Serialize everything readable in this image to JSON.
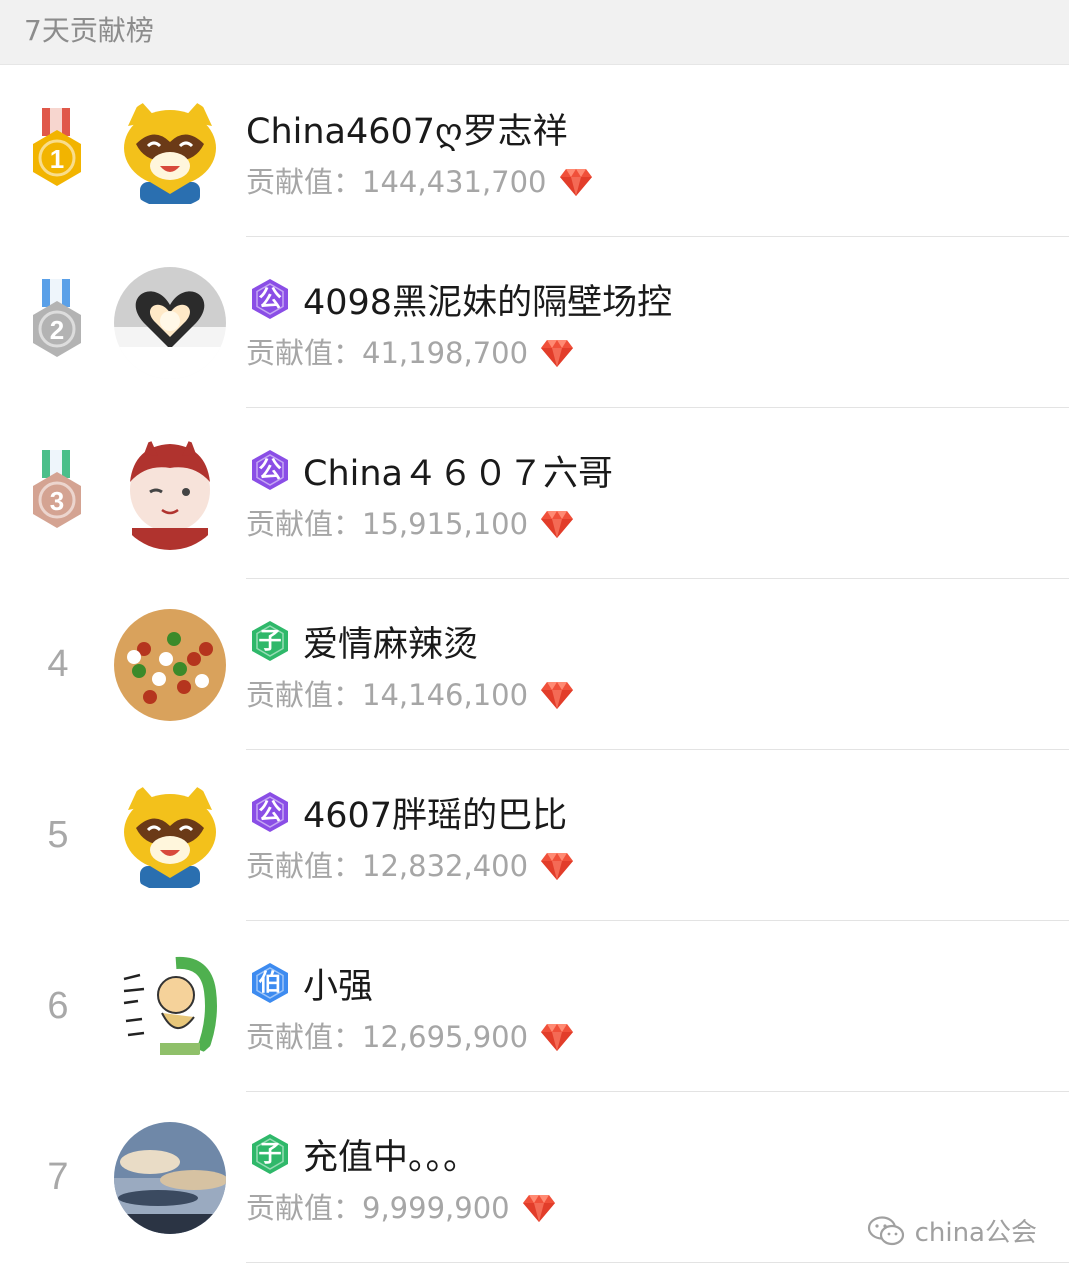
{
  "header": {
    "title": "7天贡献榜"
  },
  "value_label": "贡献值：",
  "watermark": {
    "text": "china公会"
  },
  "colors": {
    "gold": "#f2b400",
    "silver": "#b3b3b3",
    "bronze": "#d4a392",
    "badge_gong": "#8a4ee6",
    "badge_zi": "#2fb86a",
    "badge_bo": "#3d8bf0",
    "gem": "#f0503a"
  },
  "rows": [
    {
      "rank": "1",
      "name": "China4607ღ罗志祥",
      "badge": "",
      "badge_type": "none",
      "value": "144,431,700",
      "avatar": "raccoon-mascot",
      "medal": "gold"
    },
    {
      "rank": "2",
      "name": "4098黑泥妹的隔壁场控",
      "badge": "公",
      "badge_type": "gong",
      "value": "41,198,700",
      "avatar": "heart-hands",
      "medal": "silver"
    },
    {
      "rank": "3",
      "name": "China４６０７六哥",
      "badge": "公",
      "badge_type": "gong",
      "value": "15,915,100",
      "avatar": "cartoon-boy",
      "medal": "bronze"
    },
    {
      "rank": "4",
      "name": "爱情麻辣烫",
      "badge": "子",
      "badge_type": "zi",
      "value": "14,146,100",
      "avatar": "spicy-food",
      "medal": ""
    },
    {
      "rank": "5",
      "name": "4607胖瑶的巴比",
      "badge": "公",
      "badge_type": "gong",
      "value": "12,832,400",
      "avatar": "raccoon-mascot",
      "medal": ""
    },
    {
      "rank": "6",
      "name": "小强",
      "badge": "伯",
      "badge_type": "bo",
      "value": "12,695,900",
      "avatar": "cartoon-doodle",
      "medal": ""
    },
    {
      "rank": "7",
      "name": "充值中。。。",
      "badge": "子",
      "badge_type": "zi",
      "value": "9,999,900",
      "avatar": "cloudy-sky",
      "medal": ""
    }
  ]
}
